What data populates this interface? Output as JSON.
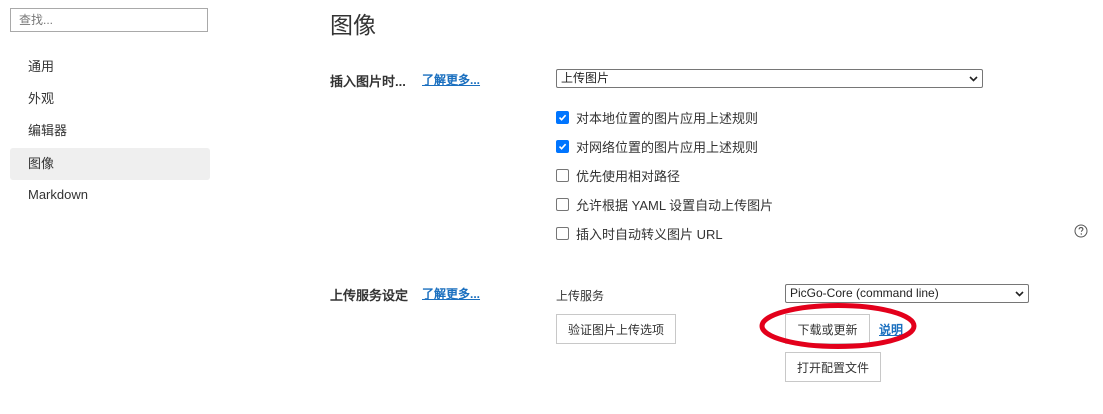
{
  "sidebar": {
    "search_placeholder": "查找...",
    "items": [
      {
        "label": "通用"
      },
      {
        "label": "外观"
      },
      {
        "label": "编辑器"
      },
      {
        "label": "图像"
      },
      {
        "label": "Markdown"
      }
    ],
    "active_item": "图像"
  },
  "page": {
    "title": "图像"
  },
  "insert_section": {
    "label": "插入图片时...",
    "learn_more": "了解更多...",
    "action_select": "上传图片",
    "options": [
      {
        "label": "对本地位置的图片应用上述规则",
        "checked": true
      },
      {
        "label": "对网络位置的图片应用上述规则",
        "checked": true
      },
      {
        "label": "优先使用相对路径",
        "checked": false
      },
      {
        "label": "允许根据 YAML 设置自动上传图片",
        "checked": false
      },
      {
        "label": "插入时自动转义图片 URL",
        "checked": false
      }
    ],
    "help_icon": "question-circle-icon"
  },
  "upload_section": {
    "label": "上传服务设定",
    "learn_more": "了解更多...",
    "service_label": "上传服务",
    "service_select": "PicGo-Core (command line)",
    "verify_button": "验证图片上传选项",
    "download_button": "下载或更新",
    "docs_link": "说明",
    "open_config_button": "打开配置文件"
  },
  "annotation": {
    "color": "#e3001b"
  },
  "colors": {
    "accent": "#0075ff",
    "link": "#1a6fbf",
    "active_nav_bg": "#efefef"
  }
}
